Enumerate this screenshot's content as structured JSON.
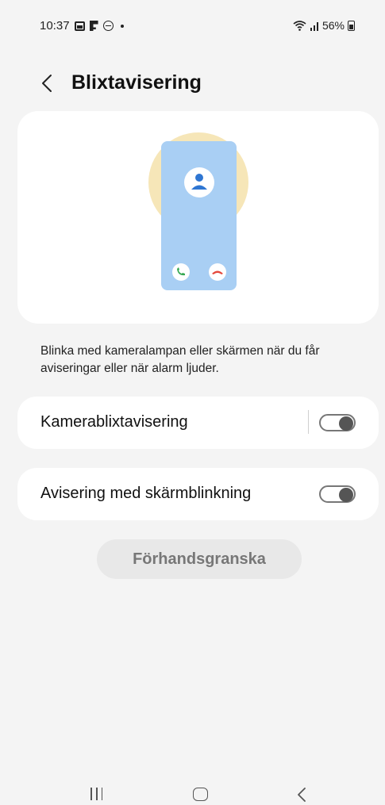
{
  "status_bar": {
    "time": "10:37",
    "battery": "56%",
    "icons": [
      "gallery-icon",
      "flipboard-icon",
      "do-not-disturb-icon",
      "dot-icon",
      "wifi-icon",
      "signal-icon",
      "battery-icon"
    ]
  },
  "header": {
    "title": "Blixtavisering",
    "back_icon": "chevron-left-icon"
  },
  "illustration": {
    "circle_color": "#f6e6b8",
    "phone_color": "#a9cff4",
    "accent_blue": "#2f76d2",
    "accept_color": "#36a852",
    "decline_color": "#e5483c"
  },
  "description": "Blinka med kameralampan eller skärmen när du får aviseringar eller när alarm ljuder.",
  "settings": [
    {
      "label": "Kamerablixtavisering",
      "enabled": false
    },
    {
      "label": "Avisering med skärmblinkning",
      "enabled": false
    }
  ],
  "preview_button": "Förhandsgranska",
  "nav_bar": {
    "icons": [
      "recents-icon",
      "home-icon",
      "back-icon"
    ]
  }
}
